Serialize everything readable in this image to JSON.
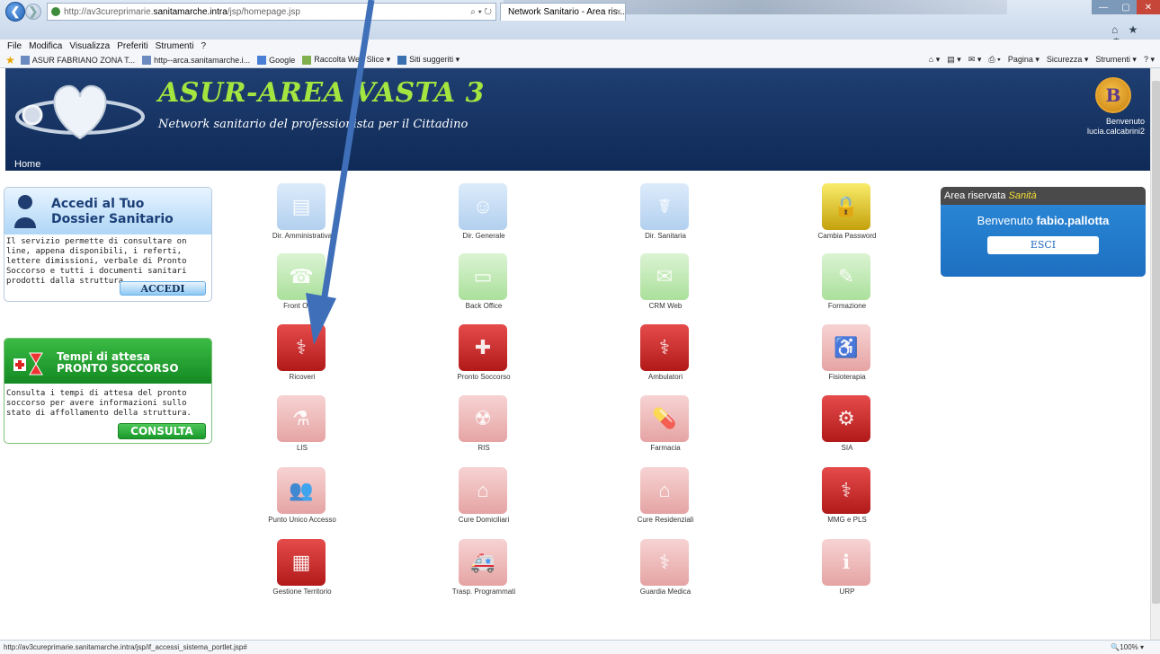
{
  "browser": {
    "url_prefix": "http://av3cureprimarie.",
    "url_host": "sanitamarche.intra",
    "url_path": "/jsp/homepage.jsp",
    "address_tools": "⌕ ▾ ↻",
    "tab_title": "Network Sanitario - Area ris...",
    "win_minimize": "—",
    "win_maximize": "▢",
    "win_close": "✕",
    "top_icons": "⌂ ★ ⚙",
    "menu": [
      "File",
      "Modifica",
      "Visualizza",
      "Preferiti",
      "Strumenti",
      "?"
    ],
    "favorites": [
      "ASUR FABRIANO ZONA T...",
      "http--arca.sanitamarche.i...",
      "Google",
      "Raccolta Web Slice ▾",
      "Siti suggeriti ▾"
    ],
    "command_bar": [
      "⌂ ▾",
      "▤ ▾",
      "✉ ▾",
      "⎙ ▾",
      "Pagina ▾",
      "Sicurezza ▾",
      "Strumenti ▾",
      "? ▾"
    ],
    "status_url": "http://av3cureprimarie.sanitamarche.intra/jsp/if_accessi_sistema_portlet.jsp#",
    "zoom": "🔍100% ▾"
  },
  "header": {
    "title": "ASUR-AREA VASTA 3",
    "subtitle": "Network sanitario del professionista per il Cittadino",
    "logo_badge": "B",
    "welcome_line1": "Benvenuto",
    "welcome_line2": "lucia.calcabrini2",
    "home": "Home"
  },
  "dossier": {
    "title_line1": "Accedi al Tuo",
    "title_line2": "Dossier Sanitario",
    "description": "Il servizio permette di consultare on line, appena disponibili, i referti, lettere dimissioni, verbale di Pronto Soccorso e tutti i documenti sanitari prodotti dalla struttura.",
    "button": "ACCEDI"
  },
  "tempi": {
    "title_line1": "Tempi di attesa",
    "title_line2": "PRONTO SOCCORSO",
    "description": "Consulta i tempi di attesa del pronto soccorso per avere informazioni sullo stato di affollamento della struttura.",
    "button": "CONSULTA"
  },
  "area_riservata": {
    "label": "Area riservata ",
    "label_em": "Sanità",
    "welcome": "Benvenuto ",
    "user": "fabio.pallotta",
    "button": "ESCI"
  },
  "apps": [
    {
      "label": "Dir. Amministrativa",
      "style": "blue-faded",
      "icon": "folders-icon",
      "glyph": "▤"
    },
    {
      "label": "Dir. Generale",
      "style": "blue-faded",
      "icon": "manager-icon",
      "glyph": "☺"
    },
    {
      "label": "Dir. Sanitaria",
      "style": "blue-faded",
      "icon": "doctor-icon",
      "glyph": "☤"
    },
    {
      "label": "Cambia Password",
      "style": "gold",
      "icon": "padlock-icon",
      "glyph": "🔒"
    },
    {
      "label": "Front Office",
      "style": "green-faded",
      "icon": "receptionist-icon",
      "glyph": "☎"
    },
    {
      "label": "Back Office",
      "style": "green-faded",
      "icon": "monitor-icon",
      "glyph": "▭"
    },
    {
      "label": "CRM Web",
      "style": "green-faded",
      "icon": "chat-icon",
      "glyph": "✉"
    },
    {
      "label": "Formazione",
      "style": "green-faded",
      "icon": "pencil-icon",
      "glyph": "✎"
    },
    {
      "label": "Ricoveri",
      "style": "red",
      "icon": "hospital-staff-icon",
      "glyph": "⚕"
    },
    {
      "label": "Pronto Soccorso",
      "style": "red",
      "icon": "first-aid-kit-icon",
      "glyph": "✚"
    },
    {
      "label": "Ambulatori",
      "style": "red",
      "icon": "clinic-icon",
      "glyph": "⚕"
    },
    {
      "label": "Fisioterapia",
      "style": "red-faded",
      "icon": "physiotherapy-icon",
      "glyph": "♿"
    },
    {
      "label": "LIS",
      "style": "red-faded",
      "icon": "flask-icon",
      "glyph": "⚗"
    },
    {
      "label": "RIS",
      "style": "red-faded",
      "icon": "radiation-icon",
      "glyph": "☢"
    },
    {
      "label": "Farmacia",
      "style": "red-faded",
      "icon": "pill-icon",
      "glyph": "💊"
    },
    {
      "label": "SIA",
      "style": "red",
      "icon": "gears-icon",
      "glyph": "⚙"
    },
    {
      "label": "Punto Unico Accesso",
      "style": "red-faded",
      "icon": "people-icon",
      "glyph": "👥"
    },
    {
      "label": "Cure Domiciliari",
      "style": "red-faded",
      "icon": "home-care-icon",
      "glyph": "⌂"
    },
    {
      "label": "Cure Residenziali",
      "style": "red-faded",
      "icon": "residence-icon",
      "glyph": "⌂"
    },
    {
      "label": "MMG e PLS",
      "style": "red",
      "icon": "physician-icon",
      "glyph": "⚕"
    },
    {
      "label": "Gestione Territorio",
      "style": "red",
      "icon": "territory-icon",
      "glyph": "▦"
    },
    {
      "label": "Trasp. Programmati",
      "style": "red-faded",
      "icon": "ambulance-icon",
      "glyph": "🚑"
    },
    {
      "label": "Guardia Medica",
      "style": "red-faded",
      "icon": "nurse-icon",
      "glyph": "⚕"
    },
    {
      "label": "URP",
      "style": "red-faded",
      "icon": "info-icon",
      "glyph": "ℹ"
    }
  ],
  "colors": {
    "header_bg": "#0f2a57",
    "title": "#a4e640",
    "arrow": "#3f6fb8"
  }
}
